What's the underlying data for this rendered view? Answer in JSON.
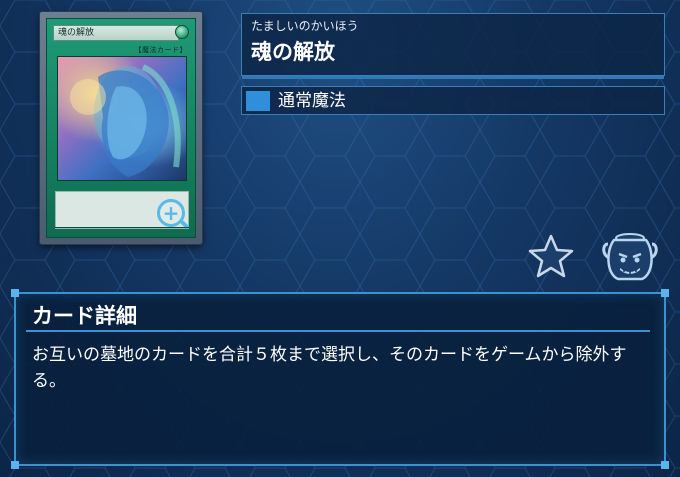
{
  "card": {
    "name": "魂の解放",
    "furigana": "たましいのかいほう",
    "type": "通常魔法",
    "frame_type_text": "【魔法カード】",
    "frame_color": "#1f9a76"
  },
  "detail": {
    "heading": "カード詳細",
    "body": "お互いの墓地のカードを合計５枚まで選択し、そのカードをゲームから除外する。"
  },
  "icons": {
    "zoom": "zoom-in-icon",
    "favorite": "star-icon",
    "pot": "pot-of-greed-icon"
  },
  "colors": {
    "accent": "#3b92d2",
    "type_marker": "#2f8fd8",
    "panel_bg": "#0d2646"
  }
}
